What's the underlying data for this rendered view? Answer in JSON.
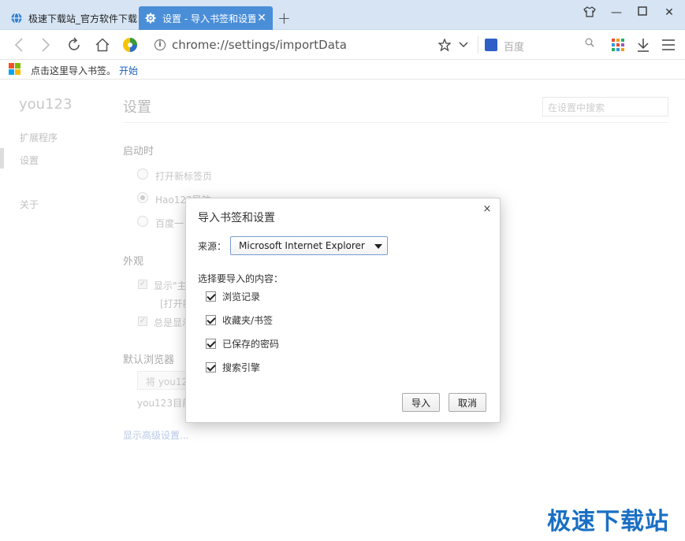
{
  "tabs": [
    {
      "title": "极速下载站_官方软件下载",
      "active": false
    },
    {
      "title": "设置 - 导入书签和设置",
      "active": true
    }
  ],
  "window": {
    "new_tab": "+",
    "skin": "👕",
    "minimize": "—",
    "maximize": "☐",
    "close": "✕"
  },
  "toolbar": {
    "url": "chrome://settings/importData",
    "search_placeholder": "百度"
  },
  "bookmark_bar": {
    "hint": "点击这里导入书签。",
    "start_link": "开始"
  },
  "sidebar": {
    "title": "you123",
    "items": [
      {
        "label": "扩展程序"
      },
      {
        "label": "设置"
      },
      {
        "label": "关于"
      }
    ]
  },
  "settings": {
    "title": "设置",
    "search_placeholder": "在设置中搜索",
    "startup": {
      "heading": "启动时",
      "options": [
        "打开新标签页",
        "Hao123导航",
        "百度一"
      ]
    },
    "appearance": {
      "heading": "外观",
      "show_label": "显示\"主",
      "open_label": "[打开新",
      "always_show": "总是显示"
    },
    "default_browser": {
      "heading": "默认浏览器",
      "button": "将 you123",
      "status": "you123目前"
    },
    "advanced_link": "显示高级设置..."
  },
  "dialog": {
    "title": "导入书签和设置",
    "close": "×",
    "source_label": "来源：",
    "source_value": "Microsoft Internet Explorer",
    "choose_label": "选择要导入的内容：",
    "items": [
      {
        "label": "浏览记录",
        "checked": true
      },
      {
        "label": "收藏夹/书签",
        "checked": true
      },
      {
        "label": "已保存的密码",
        "checked": true
      },
      {
        "label": "搜索引擎",
        "checked": true
      }
    ],
    "import_button": "导入",
    "cancel_button": "取消"
  },
  "watermark": "极速下载站"
}
